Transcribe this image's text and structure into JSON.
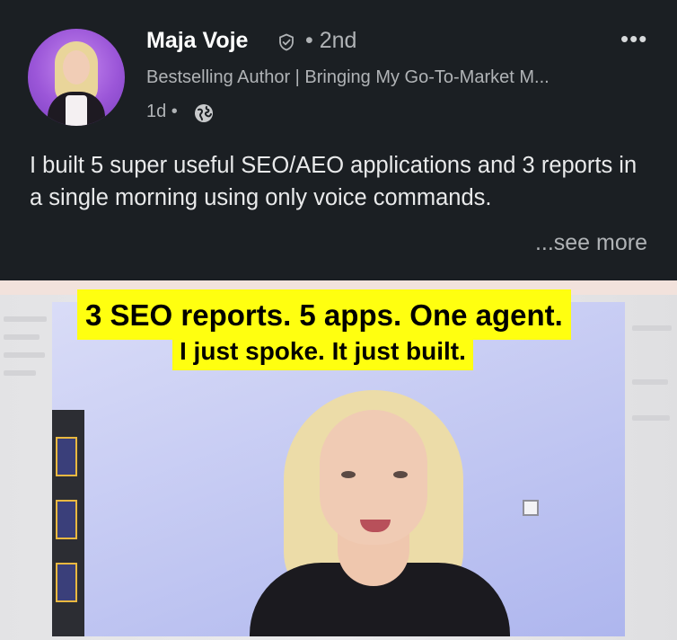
{
  "post": {
    "author_name": "Maja Voje",
    "degree": "• 2nd",
    "headline": "Bestselling Author | Bringing My Go-To-Market M...",
    "timestamp": "1d •",
    "more_options": "•••",
    "text": "I built 5 super useful SEO/AEO applications and 3 reports in a single morning using only voice commands.",
    "see_more": "...see more",
    "icons": {
      "verified": "verified-shield-icon",
      "visibility": "globe-icon",
      "menu": "more-options-icon"
    }
  },
  "media": {
    "caption_line1": "3 SEO reports. 5 apps. One agent.",
    "caption_line2": "I just spoke. It just built.",
    "caption_bg_color": "#ffff10"
  },
  "colors": {
    "background": "#1b1f23",
    "primary_text": "#ffffff",
    "secondary_text": "#b0b3b6"
  }
}
